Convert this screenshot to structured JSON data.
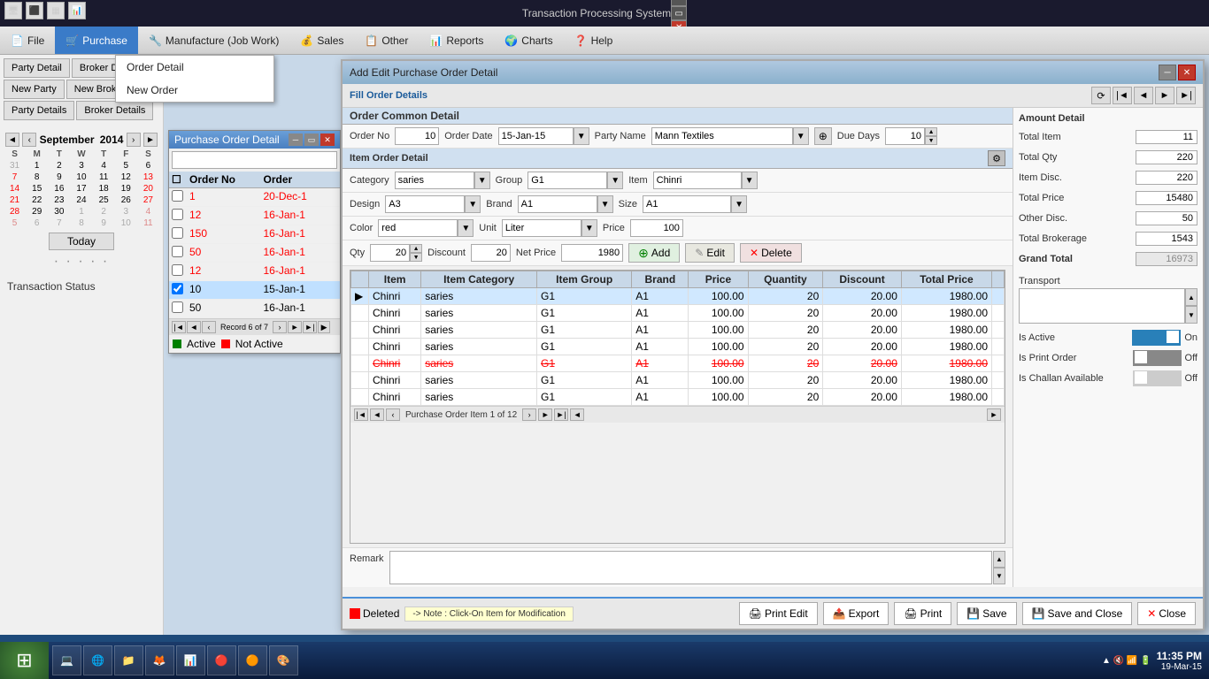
{
  "app": {
    "title": "Transaction Processing System"
  },
  "taskbar_top": {
    "title": "Transaction Processing System",
    "controls": [
      "minimize",
      "restore",
      "close"
    ]
  },
  "menu": {
    "items": [
      {
        "id": "file",
        "label": "File",
        "icon": "📄"
      },
      {
        "id": "purchase",
        "label": "Purchase",
        "icon": "🛒",
        "active": true
      },
      {
        "id": "manufacture",
        "label": "Manufacture (Job Work)",
        "icon": "🔧"
      },
      {
        "id": "sales",
        "label": "Sales",
        "icon": "💰"
      },
      {
        "id": "other",
        "label": "Other",
        "icon": "📋"
      },
      {
        "id": "reports",
        "label": "Reports",
        "icon": "📊"
      },
      {
        "id": "charts",
        "label": "Charts",
        "icon": "🌍"
      },
      {
        "id": "help",
        "label": "Help",
        "icon": "❓"
      }
    ]
  },
  "dropdown": {
    "items": [
      {
        "label": "Order Detail"
      },
      {
        "label": "New Order"
      }
    ]
  },
  "left_panel": {
    "buttons": [
      {
        "label": "Party Detail"
      },
      {
        "label": "Broker Detail"
      },
      {
        "label": "New Party"
      },
      {
        "label": "New Brokere"
      },
      {
        "label": "Party Details"
      },
      {
        "label": "Broker Details"
      }
    ],
    "calendar": {
      "prev_year": "◄",
      "prev_month": "‹",
      "month": "September",
      "year": "2014",
      "next_month": "›",
      "next_year": "►",
      "days": [
        "S",
        "M",
        "T",
        "W",
        "T",
        "F",
        "S"
      ],
      "weeks": [
        [
          "31",
          "1",
          "2",
          "3",
          "4",
          "5",
          "6"
        ],
        [
          "7",
          "8",
          "9",
          "10",
          "11",
          "12",
          "13"
        ],
        [
          "14",
          "15",
          "16",
          "17",
          "18",
          "19",
          "20"
        ],
        [
          "21",
          "22",
          "23",
          "24",
          "25",
          "26",
          "27"
        ],
        [
          "28",
          "29",
          "30",
          "1",
          "2",
          "3",
          "4"
        ],
        [
          "5",
          "6",
          "7",
          "8",
          "9",
          "10",
          "11"
        ]
      ],
      "today_btn": "Today"
    },
    "status_label": "Transaction Status"
  },
  "pod_window": {
    "title": "Purchase Order Detail"
  },
  "aepod_window": {
    "title": "Add Edit Purchase Order Detail",
    "fill_order_details": "Fill Order Details",
    "order_common_detail": "Order Common Detail",
    "order_no_label": "Order No",
    "order_no_value": "10",
    "order_date_label": "Order Date",
    "order_date_value": "15-Jan-15",
    "party_name_label": "Party Name",
    "party_name_value": "Mann Textiles",
    "due_days_label": "Due Days",
    "due_days_value": "10",
    "item_order_detail": "Item Order Detail",
    "category_label": "Category",
    "category_value": "saries",
    "group_label": "Group",
    "group_value": "G1",
    "item_label": "Item",
    "item_value": "Chinri",
    "design_label": "Design",
    "design_value": "A3",
    "brand_label": "Brand",
    "brand_value": "A1",
    "size_label": "Size",
    "size_value": "A1",
    "color_label": "Color",
    "color_value": "red",
    "unit_label": "Unit",
    "unit_value": "Liter",
    "price_label": "Price",
    "price_value": "100",
    "qty_label": "Qty",
    "qty_value": "20",
    "discount_label": "Discount",
    "discount_value": "20",
    "net_price_label": "Net Price",
    "net_price_value": "1980",
    "add_btn": "Add",
    "edit_btn": "Edit",
    "delete_btn": "Delete",
    "table": {
      "columns": [
        "Item",
        "Item Category",
        "Item Group",
        "Brand",
        "Price",
        "Quantity",
        "Discount",
        "Total Price"
      ],
      "rows": [
        {
          "item": "Chinri",
          "category": "saries",
          "group": "G1",
          "brand": "A1",
          "price": "100.00",
          "qty": "20",
          "discount": "20.00",
          "total": "1980.00",
          "selected": true,
          "deleted": false
        },
        {
          "item": "Chinri",
          "category": "saries",
          "group": "G1",
          "brand": "A1",
          "price": "100.00",
          "qty": "20",
          "discount": "20.00",
          "total": "1980.00",
          "selected": false,
          "deleted": false
        },
        {
          "item": "Chinri",
          "category": "saries",
          "group": "G1",
          "brand": "A1",
          "price": "100.00",
          "qty": "20",
          "discount": "20.00",
          "total": "1980.00",
          "selected": false,
          "deleted": false
        },
        {
          "item": "Chinri",
          "category": "saries",
          "group": "G1",
          "brand": "A1",
          "price": "100.00",
          "qty": "20",
          "discount": "20.00",
          "total": "1980.00",
          "selected": false,
          "deleted": false
        },
        {
          "item": "Chinri",
          "category": "saries",
          "group": "G1",
          "brand": "A1",
          "price": "100.00",
          "qty": "20",
          "discount": "20.00",
          "total": "1980.00",
          "selected": false,
          "deleted": true
        },
        {
          "item": "Chinri",
          "category": "saries",
          "group": "G1",
          "brand": "A1",
          "price": "100.00",
          "qty": "20",
          "discount": "20.00",
          "total": "1980.00",
          "selected": false,
          "deleted": false
        },
        {
          "item": "Chinri",
          "category": "saries",
          "group": "G1",
          "brand": "A1",
          "price": "100.00",
          "qty": "20",
          "discount": "20.00",
          "total": "1980.00",
          "selected": false,
          "deleted": false
        }
      ],
      "record_text": "Purchase Order Item 1 of 12"
    },
    "amount_detail": {
      "label": "Amount Detail",
      "total_item_label": "Total Item",
      "total_item_value": "11",
      "total_qty_label": "Total Qty",
      "total_qty_value": "220",
      "item_disc_label": "Item Disc.",
      "item_disc_value": "220",
      "total_price_label": "Total Price",
      "total_price_value": "15480",
      "other_disc_label": "Other Disc.",
      "other_disc_value": "50",
      "total_brokerage_label": "Total Brokerage",
      "total_brokerage_value": "1543",
      "grand_total_label": "Grand Total",
      "grand_total_value": "16973",
      "transport_label": "Transport",
      "is_active_label": "Is Active",
      "is_active_value": "On",
      "is_print_order_label": "Is Print Order",
      "is_print_order_value": "Off",
      "is_challan_label": "Is Challan Available",
      "is_challan_value": "Off"
    },
    "remark_label": "Remark",
    "deleted_label": "Deleted",
    "note_text": "-> Note : Click-On Item for Modification",
    "print_edit_btn": "Print Edit",
    "export_btn": "Export",
    "print_btn": "Print",
    "save_btn": "Save",
    "save_close_btn": "Save and Close",
    "close_btn": "Close"
  },
  "legend": {
    "active_label": "Active",
    "not_active_label": "Not Active"
  },
  "taskbar": {
    "time": "11:35 PM",
    "date": "19-Mar-15"
  }
}
